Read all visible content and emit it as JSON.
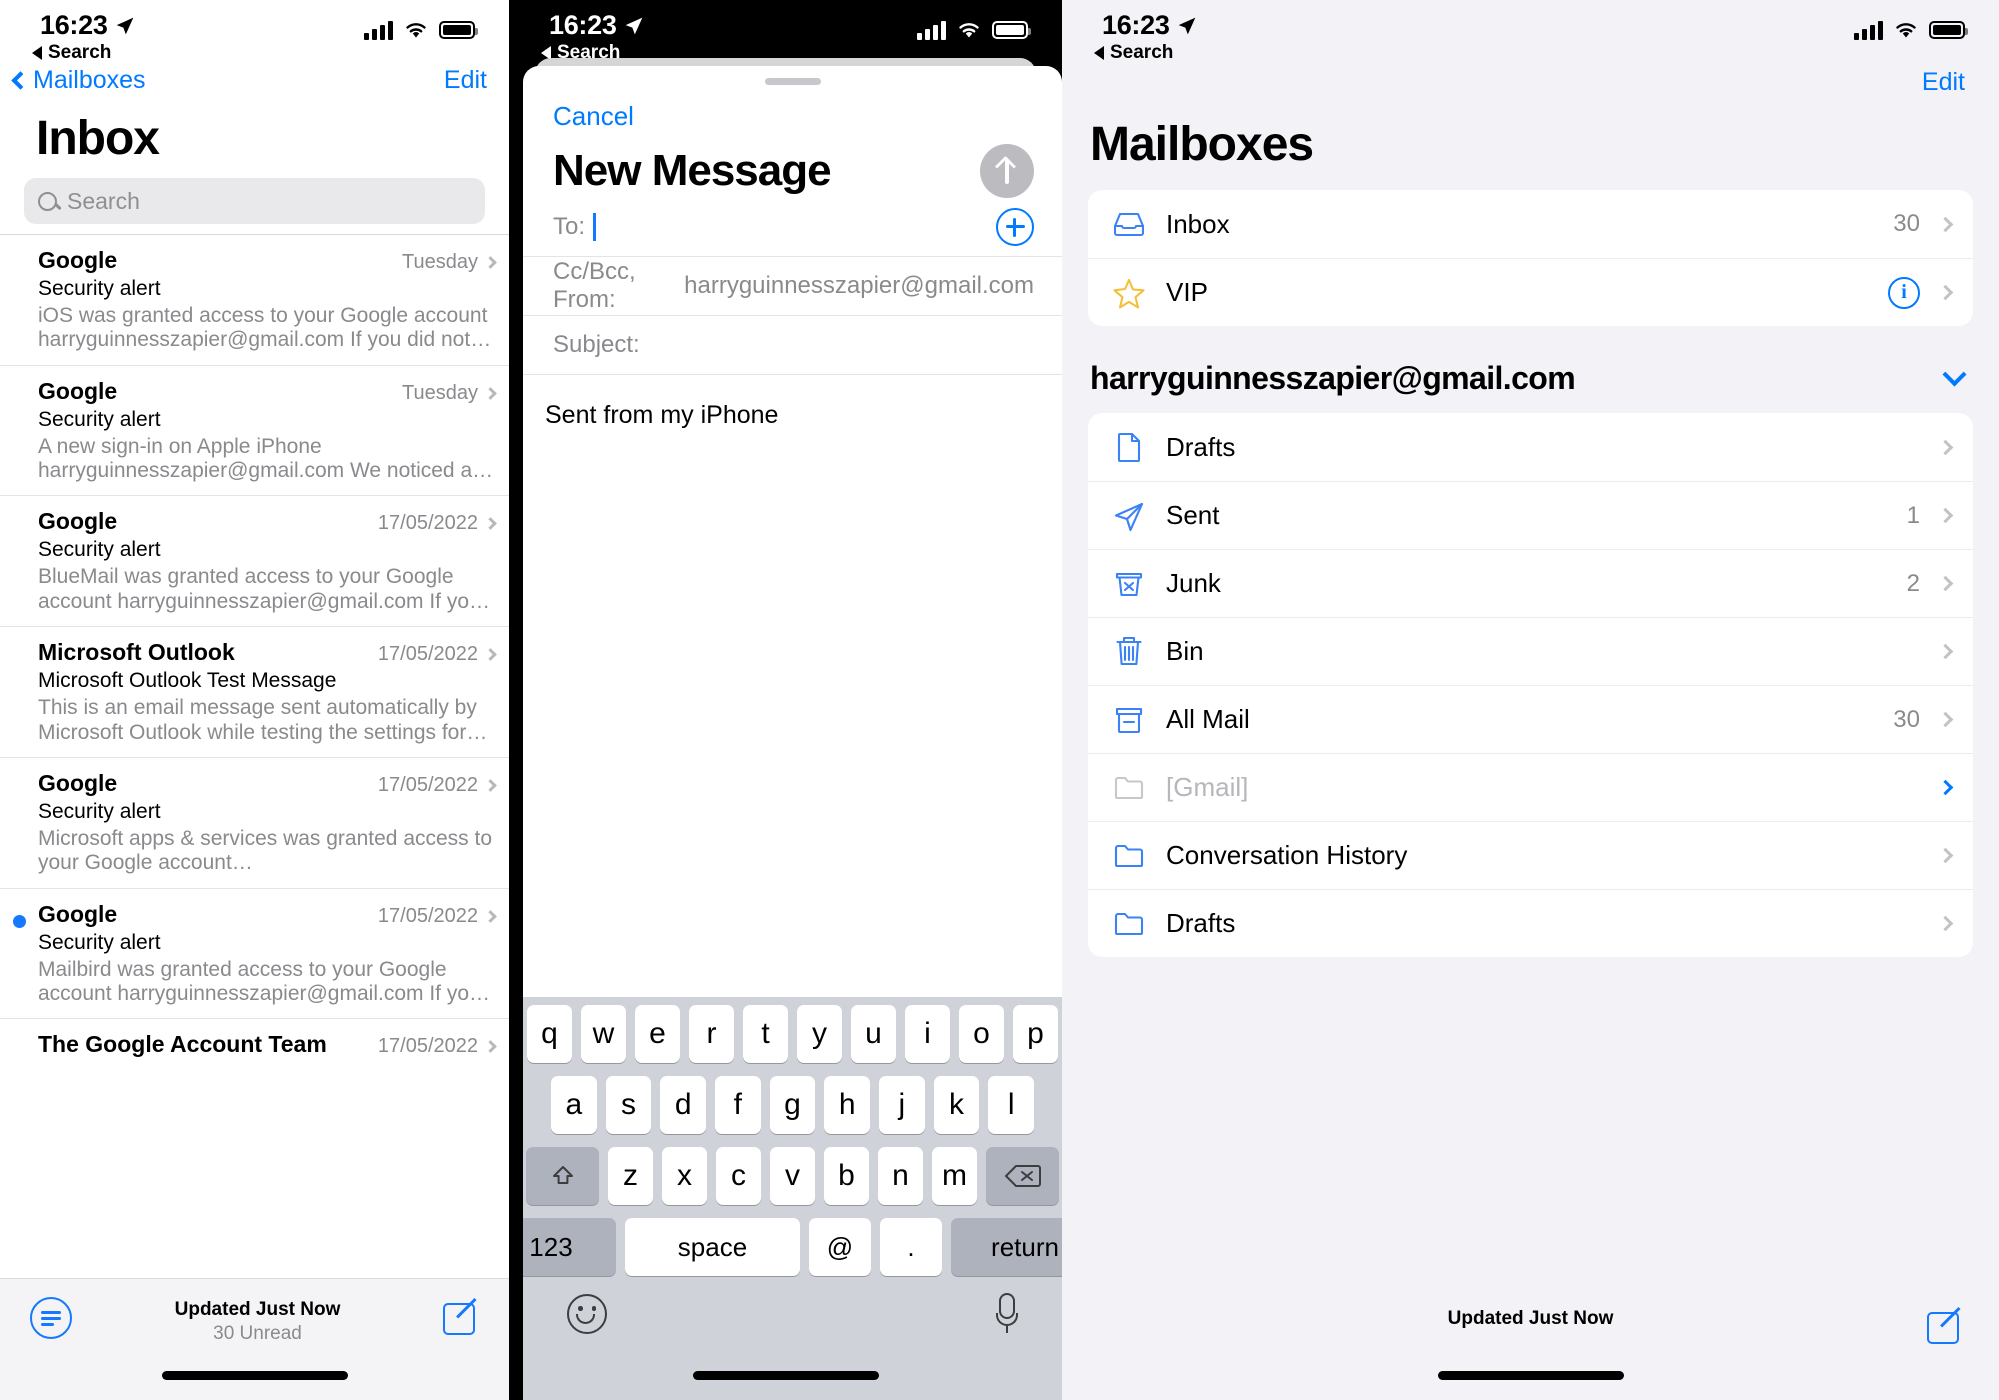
{
  "status_bar": {
    "time": "16:23",
    "back_label": "Search",
    "location_icon": "location-arrow-icon"
  },
  "panel1": {
    "back_label": "Mailboxes",
    "edit_label": "Edit",
    "title": "Inbox",
    "search_placeholder": "Search",
    "emails": [
      {
        "sender": "Google",
        "date": "Tuesday",
        "subject": "Security alert",
        "preview": "iOS was granted access to your Google account harryguinnesszapier@gmail.com If you did not gran…",
        "unread": false
      },
      {
        "sender": "Google",
        "date": "Tuesday",
        "subject": "Security alert",
        "preview": "A new sign-in on Apple iPhone harryguinnesszapier@gmail.com We noticed a new…",
        "unread": false
      },
      {
        "sender": "Google",
        "date": "17/05/2022",
        "subject": "Security alert",
        "preview": "BlueMail was granted access to your Google account harryguinnesszapier@gmail.com If you did not gran…",
        "unread": false
      },
      {
        "sender": "Microsoft Outlook",
        "date": "17/05/2022",
        "subject": "Microsoft Outlook Test Message",
        "preview": "This is an email message sent automatically by Microsoft Outlook while testing the settings for you…",
        "unread": false
      },
      {
        "sender": "Google",
        "date": "17/05/2022",
        "subject": "Security alert",
        "preview": "Microsoft apps & services was granted access to your Google account harryguinnesszapier@gmail.c…",
        "unread": false
      },
      {
        "sender": "Google",
        "date": "17/05/2022",
        "subject": "Security alert",
        "preview": "Mailbird was granted access to your Google account harryguinnesszapier@gmail.com If you did not gran…",
        "unread": true
      },
      {
        "sender": "The Google Account Team",
        "date": "17/05/2022",
        "subject": "",
        "preview": "",
        "unread": false
      }
    ],
    "footer": {
      "updated": "Updated Just Now",
      "unread_count": "30 Unread",
      "filter_icon": "filter-icon",
      "compose_icon": "compose-icon"
    }
  },
  "panel2": {
    "cancel_label": "Cancel",
    "title": "New Message",
    "send_icon": "send-arrow-up-icon",
    "to_label": "To:",
    "to_value": "",
    "add_contact_icon": "plus-circle-icon",
    "ccbcc_label": "Cc/Bcc, From:",
    "ccbcc_value": "harryguinnesszapier@gmail.com",
    "subject_label": "Subject:",
    "subject_value": "",
    "body": "Sent from my iPhone",
    "keyboard": {
      "row1": [
        "q",
        "w",
        "e",
        "r",
        "t",
        "y",
        "u",
        "i",
        "o",
        "p"
      ],
      "row2": [
        "a",
        "s",
        "d",
        "f",
        "g",
        "h",
        "j",
        "k",
        "l"
      ],
      "row3": [
        "z",
        "x",
        "c",
        "v",
        "b",
        "n",
        "m"
      ],
      "shift_icon": "shift-up-icon",
      "delete_icon": "delete-backspace-icon",
      "numbers_label": "123",
      "space_label": "space",
      "at_label": "@",
      "period_label": ".",
      "return_label": "return",
      "emoji_icon": "emoji-smiley-icon",
      "mic_icon": "microphone-icon"
    }
  },
  "panel3": {
    "edit_label": "Edit",
    "title": "Mailboxes",
    "top_mailboxes": [
      {
        "label": "Inbox",
        "count": "30",
        "icon": "inbox-tray-icon",
        "accessory": "chevron"
      },
      {
        "label": "VIP",
        "count": "",
        "icon": "star-icon",
        "accessory": "info"
      }
    ],
    "account_name": "harryguinnesszapier@gmail.com",
    "account_chevron_icon": "chevron-down-icon",
    "account_mailboxes": [
      {
        "label": "Drafts",
        "count": "",
        "icon": "document-icon",
        "dim": false
      },
      {
        "label": "Sent",
        "count": "1",
        "icon": "paper-plane-icon",
        "dim": false
      },
      {
        "label": "Junk",
        "count": "2",
        "icon": "junk-bin-x-icon",
        "dim": false
      },
      {
        "label": "Bin",
        "count": "",
        "icon": "trash-icon",
        "dim": false
      },
      {
        "label": "All Mail",
        "count": "30",
        "icon": "archive-box-icon",
        "dim": false
      },
      {
        "label": "[Gmail]",
        "count": "",
        "icon": "folder-icon",
        "dim": true
      },
      {
        "label": "Conversation History",
        "count": "",
        "icon": "folder-icon",
        "dim": false
      },
      {
        "label": "Drafts",
        "count": "",
        "icon": "folder-icon",
        "dim": false
      }
    ],
    "footer": {
      "updated": "Updated Just Now",
      "compose_icon": "compose-icon"
    }
  },
  "colors": {
    "accent_blue": "#007aff",
    "unread_blue": "#1479ff",
    "star_yellow": "#f5bf3c",
    "muted_gray": "#8a8a8e"
  }
}
